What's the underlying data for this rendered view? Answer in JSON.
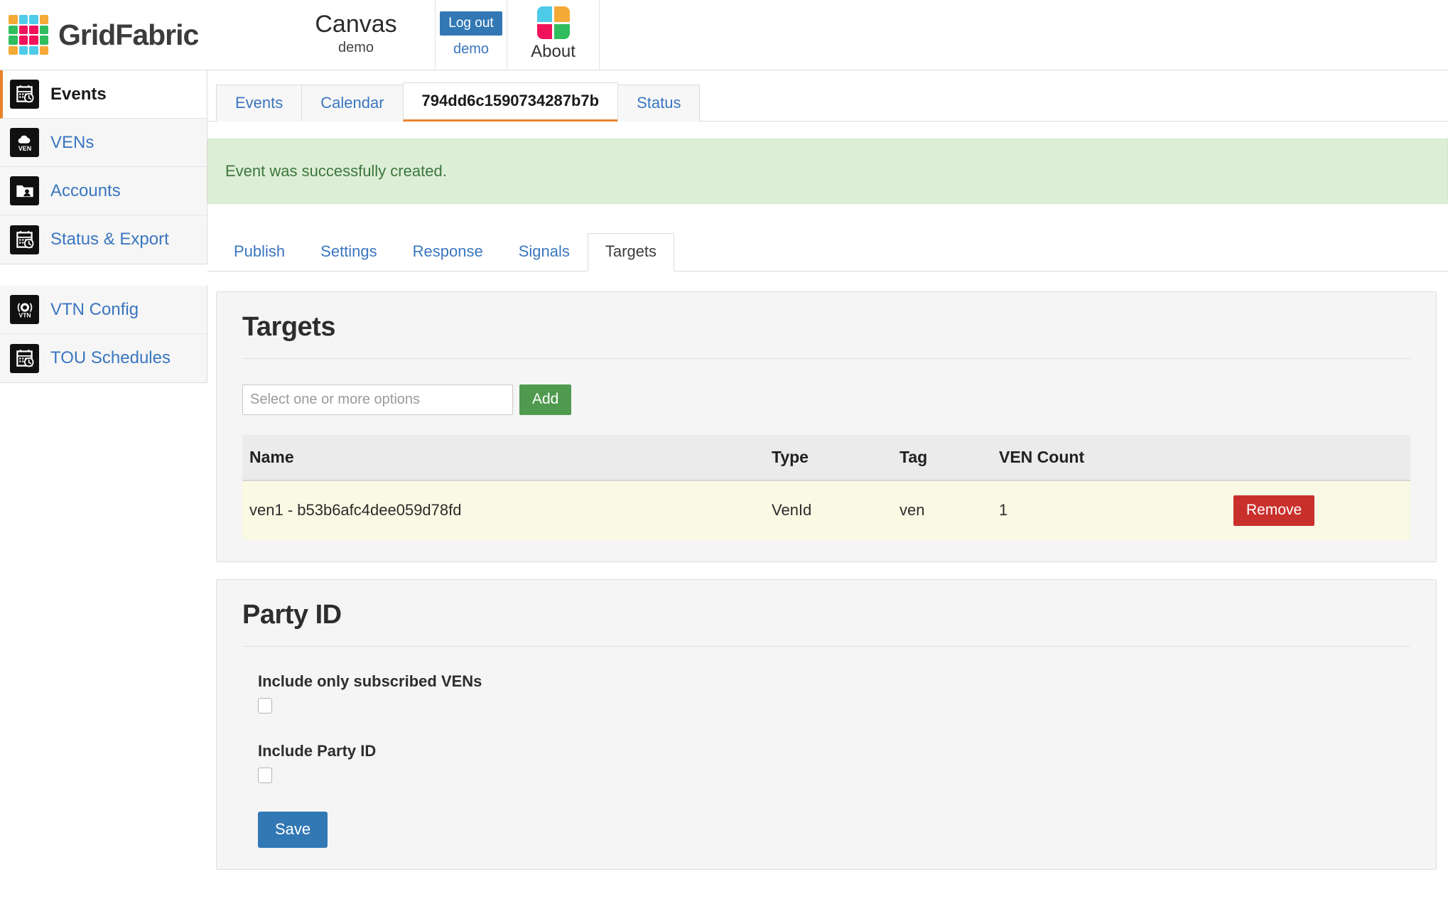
{
  "header": {
    "brand_name": "GridFabric",
    "logo_icon": "gridfabric-logo-icon",
    "logo_colors": [
      "#f5a937",
      "#4ecbe8",
      "#4ecbe8",
      "#f5a937",
      "#2fbd5e",
      "#f0135c",
      "#f0135c",
      "#2fbd5e",
      "#2fbd5e",
      "#f0135c",
      "#f0135c",
      "#2fbd5e",
      "#f5a937",
      "#4ecbe8",
      "#4ecbe8",
      "#f5a937"
    ],
    "app_title": "Canvas",
    "app_subtitle": "demo",
    "logout_label": "Log out",
    "logout_user": "demo",
    "about_label": "About",
    "about_icon": "about-grid-icon",
    "about_colors": [
      "#4ecbe8",
      "#f5a937",
      "#f0135c",
      "#2fbd5e"
    ],
    "accent_blue": "#3278b4",
    "link_blue": "#3a76c0"
  },
  "sidebar": {
    "groups": [
      {
        "items": [
          {
            "label": "Events",
            "icon": "calendar-clock-icon",
            "active": true
          },
          {
            "label": "VENs",
            "icon": "cloud-ven-icon",
            "active": false
          },
          {
            "label": "Accounts",
            "icon": "folder-user-icon",
            "active": false
          },
          {
            "label": "Status & Export",
            "icon": "calendar-clock-icon",
            "active": false
          }
        ]
      },
      {
        "items": [
          {
            "label": "VTN Config",
            "icon": "gear-vtn-icon",
            "active": false
          },
          {
            "label": "TOU Schedules",
            "icon": "calendar-clock-icon",
            "active": false
          }
        ]
      }
    ]
  },
  "main": {
    "tabs": [
      {
        "label": "Events",
        "active": false
      },
      {
        "label": "Calendar",
        "active": false
      },
      {
        "label": "794dd6c1590734287b7b",
        "active": true
      },
      {
        "label": "Status",
        "active": false
      }
    ],
    "alert": {
      "message": "Event was successfully created.",
      "type": "success",
      "bg_color": "#ddeed6",
      "text_color": "#3c763d"
    },
    "subtabs": [
      {
        "label": "Publish",
        "active": false
      },
      {
        "label": "Settings",
        "active": false
      },
      {
        "label": "Response",
        "active": false
      },
      {
        "label": "Signals",
        "active": false
      },
      {
        "label": "Targets",
        "active": true
      }
    ],
    "targets_panel": {
      "title": "Targets",
      "select_placeholder": "Select one or more options",
      "select_value": "",
      "add_label": "Add",
      "add_color": "#4f9a4f",
      "table": {
        "headers": [
          "Name",
          "Type",
          "Tag",
          "VEN Count",
          ""
        ],
        "rows": [
          {
            "name": "ven1 - b53b6afc4dee059d78fd",
            "type": "VenId",
            "tag": "ven",
            "ven_count": "1",
            "remove_label": "Remove",
            "remove_color": "#c9302c",
            "row_bg": "#f9f9e4"
          }
        ]
      }
    },
    "party_panel": {
      "title": "Party ID",
      "fields": [
        {
          "label": "Include only subscribed VENs",
          "checked": false
        },
        {
          "label": "Include Party ID",
          "checked": false
        }
      ],
      "save_label": "Save",
      "save_color": "#3278b4"
    }
  }
}
